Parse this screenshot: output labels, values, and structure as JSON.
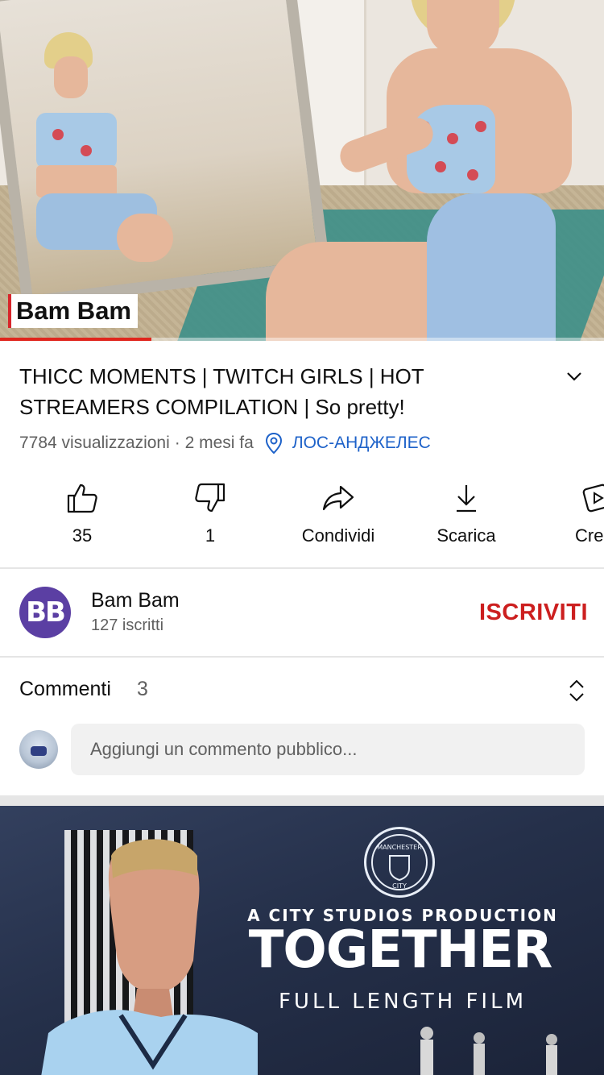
{
  "player": {
    "watermark": "Bam Bam",
    "progress_fraction": 0.25,
    "accent_color": "#e0261d"
  },
  "video": {
    "title": "THICC MOMENTS | TWITCH GIRLS  | HOT STREAMERS COMPILATION | So pretty!",
    "views": "7784 visualizzazioni",
    "age": "· 2 mesi fa",
    "location": "ЛОС-АНДЖЕЛЕС",
    "location_color": "#1e62c9"
  },
  "actions": {
    "like": {
      "label": "35",
      "icon": "thumb-up-icon"
    },
    "dislike": {
      "label": "1",
      "icon": "thumb-down-icon"
    },
    "share": {
      "label": "Condividi",
      "icon": "share-icon"
    },
    "download": {
      "label": "Scarica",
      "icon": "download-icon"
    },
    "create": {
      "label": "Crea",
      "icon": "create-clip-icon"
    }
  },
  "channel": {
    "avatar_text": "BB",
    "name": "Bam Bam",
    "subscribers": "127 iscritti",
    "subscribe_label": "ISCRIVITI",
    "subscribe_color": "#cc1f1f"
  },
  "comments": {
    "title": "Commenti",
    "count": "3",
    "placeholder": "Aggiungi un commento pubblico..."
  },
  "next_video": {
    "badge_top": "MANCHESTER",
    "badge_bottom": "CITY",
    "line1": "A CITY STUDIOS PRODUCTION",
    "line2": "TOGETHER",
    "line3": "FULL LENGTH FILM"
  }
}
